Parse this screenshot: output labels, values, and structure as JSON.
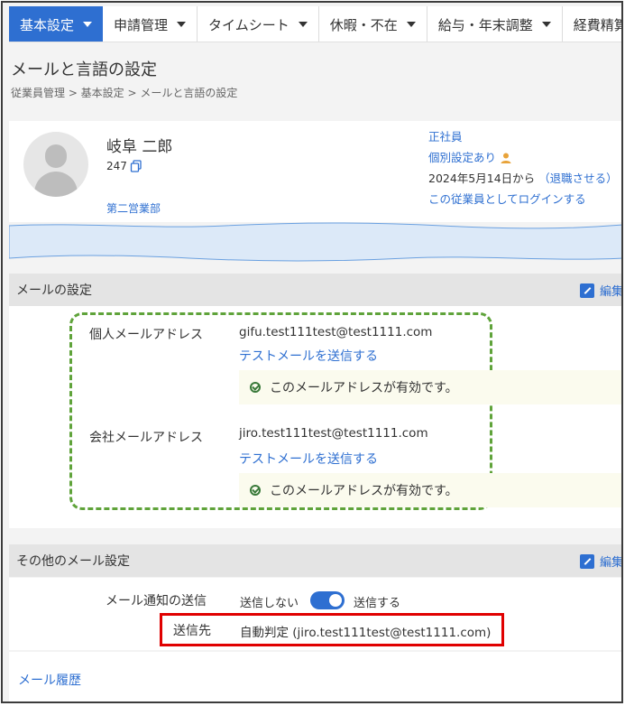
{
  "nav": {
    "items": [
      {
        "label": "基本設定",
        "active": true
      },
      {
        "label": "申請管理"
      },
      {
        "label": "タイムシート"
      },
      {
        "label": "休暇・不在"
      },
      {
        "label": "給与・年末調整"
      },
      {
        "label": "経費精算"
      }
    ]
  },
  "page": {
    "title": "メールと言語の設定",
    "breadcrumb": "従業員管理 > 基本設定 > メールと言語の設定"
  },
  "profile": {
    "name": "岐阜 二郎",
    "employee_no": "247",
    "department": "第二営業部",
    "employment_type": "正社員",
    "individual_settings": "個別設定あり",
    "since": "2024年5月14日から",
    "retire_link": "（退職させる）",
    "login_as": "この従業員としてログインする"
  },
  "mail_settings": {
    "header": "メールの設定",
    "edit_label": "編集",
    "personal_label": "個人メールアドレス",
    "personal_email": "gifu.test111test@test1111.com",
    "personal_test_link": "テストメールを送信する",
    "personal_valid": "このメールアドレスが有効です。",
    "company_label": "会社メールアドレス",
    "company_email": "jiro.test111test@test1111.com",
    "company_test_link": "テストメールを送信する",
    "company_valid": "このメールアドレスが有効です。"
  },
  "other_settings": {
    "header": "その他のメール設定",
    "edit_label": "編集",
    "notify_label": "メール通知の送信",
    "toggle_off_label": "送信しない",
    "toggle_on_label": "送信する",
    "toggle_on": true,
    "recipient_label": "送信先",
    "recipient_value": "自動判定 (jiro.test111test@test1111.com)"
  },
  "footer": {
    "history_link": "メール履歴"
  },
  "colors": {
    "accent": "#2e6fd1",
    "dashed_highlight": "#5fa33a",
    "red_highlight": "#e00000"
  }
}
